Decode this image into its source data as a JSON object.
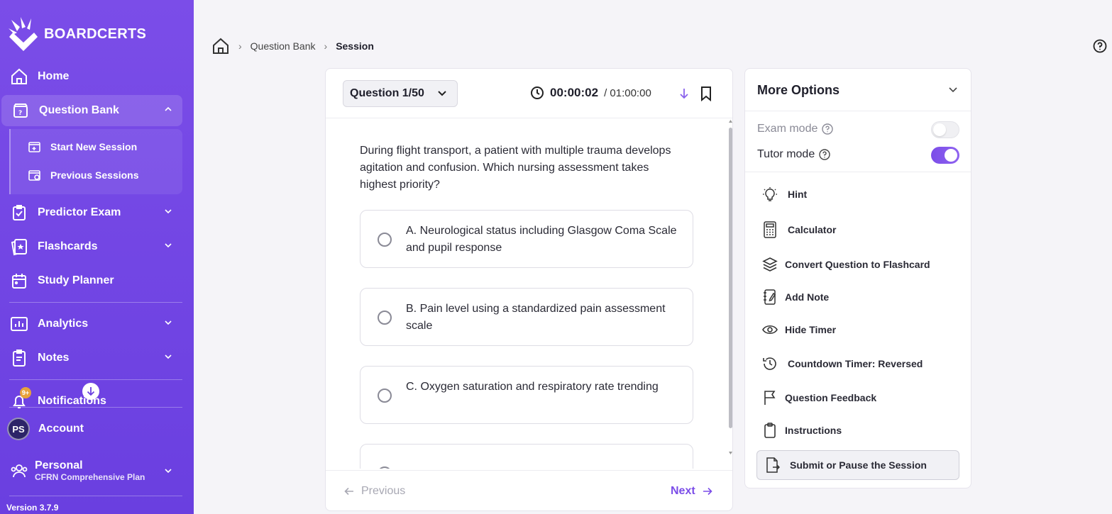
{
  "brand": {
    "name": "BOARDCERTS"
  },
  "sidebar": {
    "items": [
      {
        "label": "Home",
        "icon": "home-icon"
      },
      {
        "label": "Question Bank",
        "icon": "question-bank-icon",
        "expanded": true
      },
      {
        "label": "Predictor Exam",
        "icon": "predictor-exam-icon"
      },
      {
        "label": "Flashcards",
        "icon": "flashcards-icon"
      },
      {
        "label": "Study Planner",
        "icon": "calendar-icon"
      },
      {
        "label": "Analytics",
        "icon": "analytics-icon"
      },
      {
        "label": "Notes",
        "icon": "notes-icon"
      },
      {
        "label": "Notifications",
        "icon": "bell-icon"
      }
    ],
    "submenu": [
      {
        "label": "Start New Session",
        "icon": "start-session-icon"
      },
      {
        "label": "Previous Sessions",
        "icon": "previous-sessions-icon"
      }
    ],
    "notifications_badge": "9+",
    "account": {
      "label": "Account",
      "initials": "PS"
    },
    "plan": {
      "label": "Personal",
      "subtitle": "CFRN Comprehensive Plan"
    },
    "version": "Version 3.7.9"
  },
  "breadcrumb": [
    "Question Bank",
    "Session"
  ],
  "question": {
    "selector_label": "Question 1/50",
    "timer_elapsed": "00:00:02",
    "timer_total": "/ 01:00:00",
    "text": "During flight transport, a patient with multiple trauma develops agitation and confusion. Which nursing assessment takes highest priority?",
    "options": [
      "A. Neurological status including Glasgow Coma Scale and pupil response",
      "B. Pain level using a standardized pain assessment scale",
      "C. Oxygen saturation and respiratory rate trending"
    ],
    "prev_label": "Previous",
    "next_label": "Next"
  },
  "more_options": {
    "title": "More Options",
    "exam_mode": {
      "label": "Exam mode",
      "enabled": false
    },
    "tutor_mode": {
      "label": "Tutor mode",
      "enabled": true
    },
    "items": [
      {
        "label": "Hint",
        "icon": "lightbulb-icon"
      },
      {
        "label": "Calculator",
        "icon": "calculator-icon"
      },
      {
        "label": "Convert Question to Flashcard",
        "icon": "layers-icon"
      },
      {
        "label": "Add Note",
        "icon": "note-icon"
      },
      {
        "label": "Hide Timer",
        "icon": "eye-icon"
      },
      {
        "label": "Countdown Timer: Reversed",
        "icon": "history-icon"
      },
      {
        "label": "Question Feedback",
        "icon": "flag-icon"
      },
      {
        "label": "Instructions",
        "icon": "clipboard-icon"
      }
    ],
    "submit_label": "Submit or Pause the Session"
  },
  "colors": {
    "accent": "#7b4de8",
    "sidebar": "#6a3fe0",
    "badge": "#e8a23c"
  }
}
